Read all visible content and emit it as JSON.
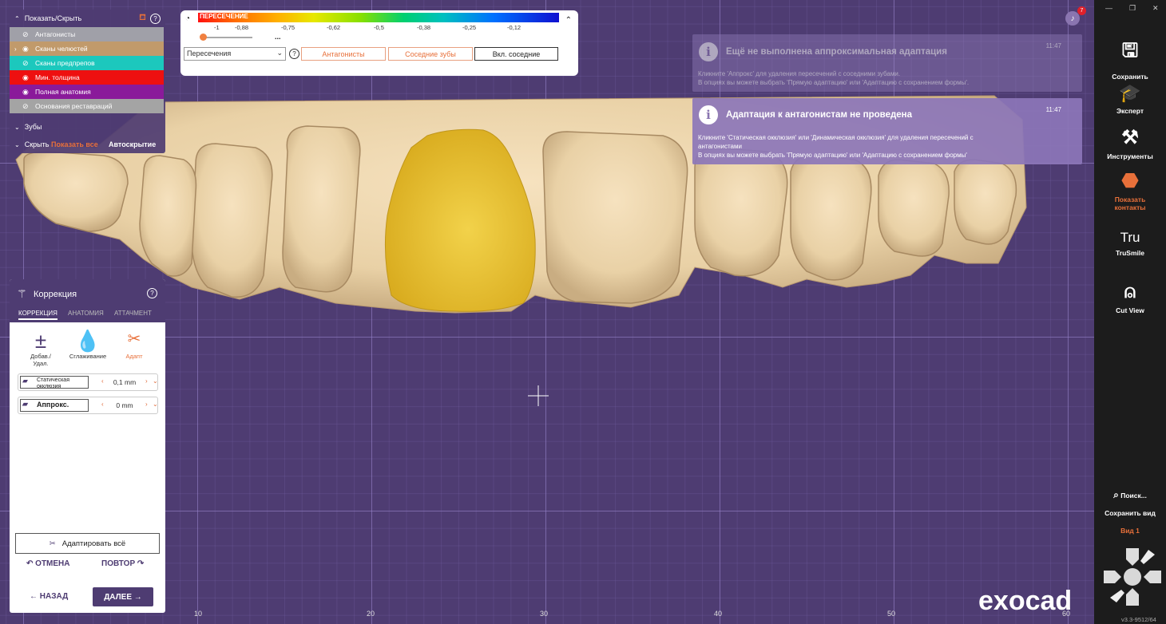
{
  "show_hide": {
    "title": "Показать/Скрыть",
    "layers": [
      {
        "label": "Антагонисты",
        "color": "#a0a0a8"
      },
      {
        "label": "Сканы челюстей",
        "color": "#c19a6b"
      },
      {
        "label": "Сканы предпрепов",
        "color": "#1cc8bd"
      },
      {
        "label": "Мин. толщина",
        "color": "#ee1010"
      },
      {
        "label": "Полная анатомия",
        "color": "#8a1a9a"
      },
      {
        "label": "Основания реставраций",
        "color": "#a4a4a4"
      }
    ],
    "teeth_label": "Зубы",
    "hidden_label": "Скрыть",
    "show_all": "Показать все",
    "auto_hide": "Автоскрытие"
  },
  "intersection": {
    "title": "ПЕРЕСЕЧЕНИЕ",
    "ticks": [
      "-1",
      "-0,88",
      "-0,75",
      "-0,62",
      "-0,5",
      "-0,38",
      "-0,25",
      "-0,12"
    ],
    "slider_value": "...",
    "mode": "Пересечения",
    "buttons": [
      "Антагонисты",
      "Соседние зубы",
      "Вкл. соседние"
    ]
  },
  "notifications": [
    {
      "title": "Ещё не выполнена аппроксимальная адаптация",
      "time": "11:47",
      "line1": "Кликните 'Аппрокс' для удаления пересечений с соседними зубами.",
      "line2": "В опциях вы можете выбрать 'Прямую адаптацию' или 'Адаптацию с сохранением формы'."
    },
    {
      "title": "Адаптация к антагонистам не проведена",
      "time": "11:47",
      "line1": "Кликните 'Статическая окклюзия' или 'Динамическая окклюзия' для удаления пересечений с",
      "line1b": "антагонистами",
      "line2": "В опциях вы можете выбрать 'Прямую адаптацию' или 'Адаптацию с сохранением формы'"
    }
  ],
  "correction": {
    "title": "Коррекция",
    "tabs": [
      "КОРРЕКЦИЯ",
      "АНАТОМИЯ",
      "АТТАЧМЕНТ"
    ],
    "tools": [
      {
        "label1": "Добав./",
        "label2": "Удал."
      },
      {
        "label1": "Сглаживание",
        "label2": ""
      },
      {
        "label1": "Адапт",
        "label2": ""
      }
    ],
    "params": [
      {
        "label": "Статическая окклюзия",
        "value": "0,1 mm"
      },
      {
        "label": "Аппрокс.",
        "value": "0 mm"
      }
    ],
    "adapt_all": "Адаптировать всё",
    "undo": "ОТМЕНА",
    "redo": "ПОВТОР",
    "back": "НАЗАД",
    "next": "ДАЛЕЕ"
  },
  "sidebar": {
    "items": [
      "Сохранить",
      "Эксперт",
      "Инструменты",
      "Показать",
      "контакты",
      "TruSmile",
      "Cut View"
    ],
    "search": "Поиск...",
    "save_view": "Сохранить вид",
    "view1": "Вид 1",
    "version": "v3.3-9512/64",
    "accent": "#e8703a"
  },
  "notifications_count": "7",
  "axis": [
    "10",
    "20",
    "30",
    "40",
    "50",
    "60"
  ],
  "brand": "exocad"
}
